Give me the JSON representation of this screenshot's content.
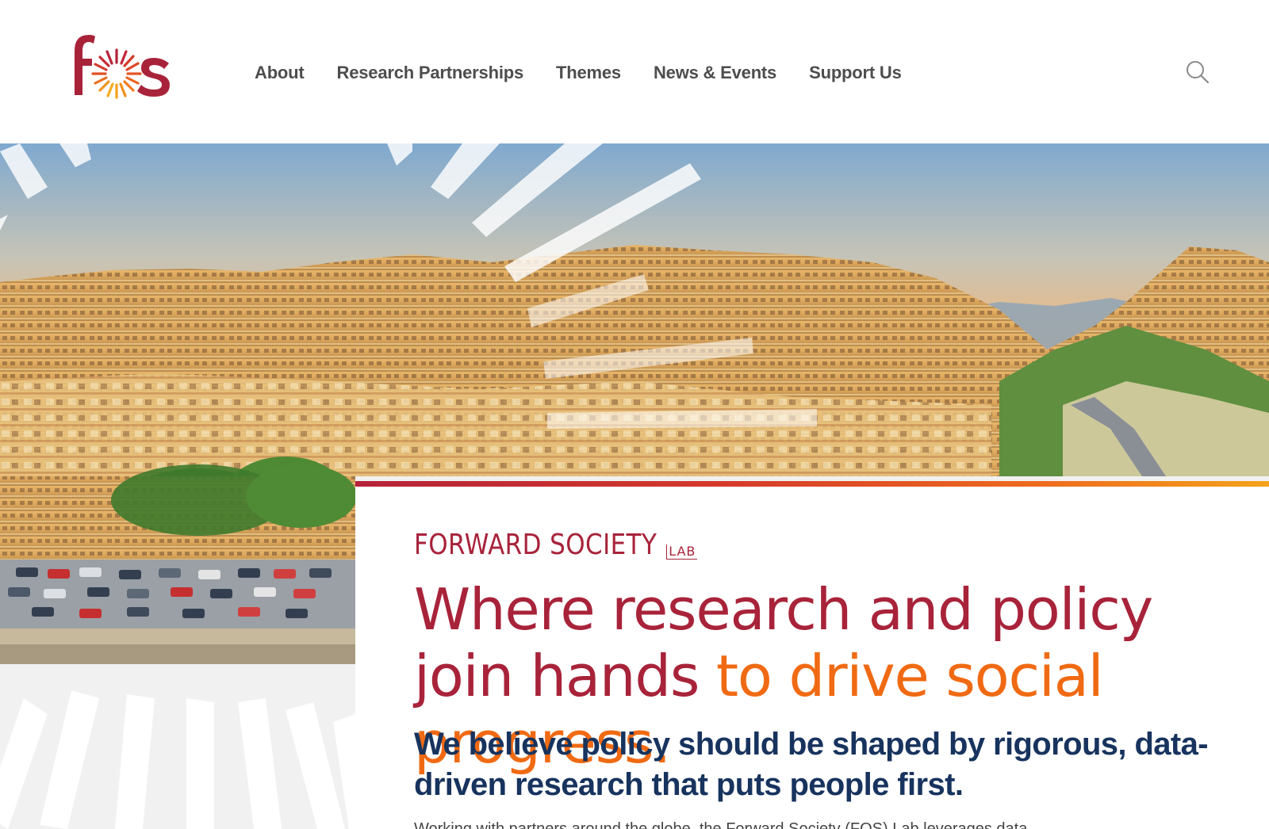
{
  "brand": {
    "logo_text": "fos",
    "primary_color": "#a8233a",
    "accent_color": "#f06a13",
    "navy_color": "#17335e"
  },
  "nav": {
    "items": [
      {
        "label": "About"
      },
      {
        "label": "Research Partnerships"
      },
      {
        "label": "Themes"
      },
      {
        "label": "News & Events"
      },
      {
        "label": "Support Us"
      }
    ],
    "search_icon": "search-icon"
  },
  "hero": {
    "eyebrow": "FORWARD SOCIETY",
    "eyebrow_suffix": "LAB",
    "headline_part1": "Where research and policy join hands ",
    "headline_part2": "to drive social progress.",
    "subhead": "We believe policy should be shaped by rigorous, data-driven research that puts people first.",
    "body": "Working with partners around the globe, the Forward Society (FOS) Lab leverages data"
  }
}
